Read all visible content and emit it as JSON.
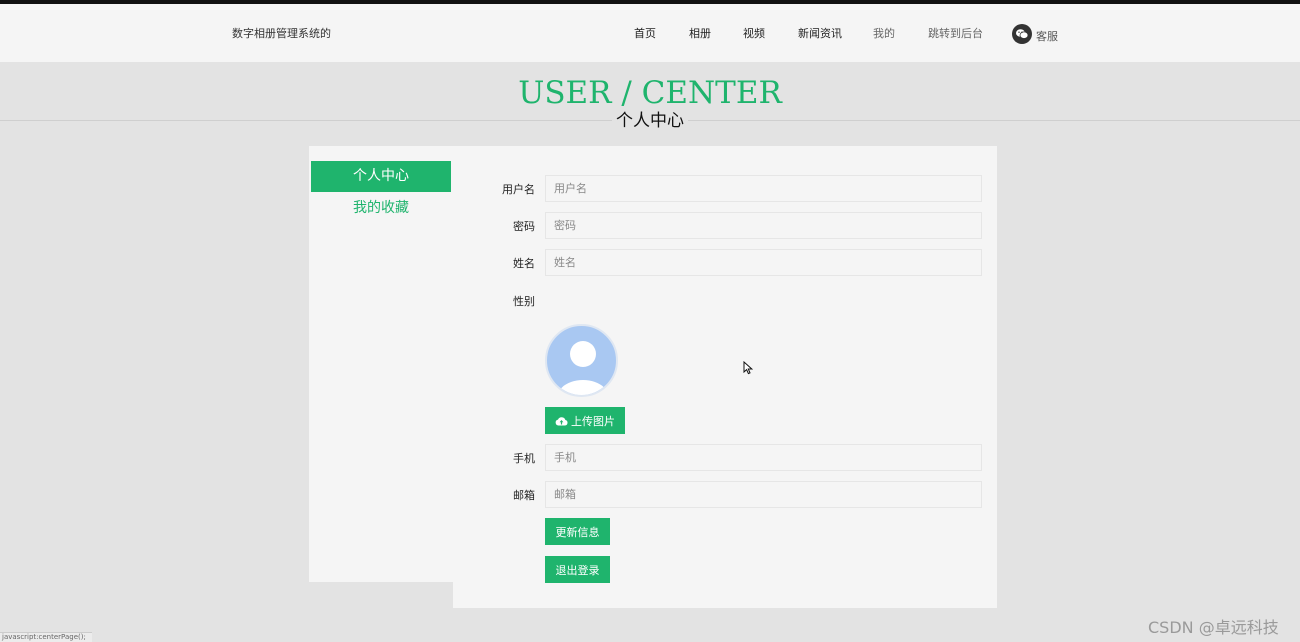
{
  "header": {
    "site_title": "数字相册管理系统的",
    "nav": {
      "home": "首页",
      "albums": "相册",
      "videos": "视频",
      "news": "新闻资讯",
      "mine": "我的",
      "backend": "跳转到后台",
      "service": "客服"
    }
  },
  "hero": {
    "title": "USER / CENTER",
    "subtitle": "个人中心"
  },
  "sidebar": {
    "items": [
      {
        "label": "个人中心",
        "active": true
      },
      {
        "label": "我的收藏",
        "active": false
      }
    ]
  },
  "form": {
    "username": {
      "label": "用户名",
      "placeholder": "用户名"
    },
    "password": {
      "label": "密码",
      "placeholder": "密码"
    },
    "name": {
      "label": "姓名",
      "placeholder": "姓名"
    },
    "gender": {
      "label": "性别"
    },
    "phone": {
      "label": "手机",
      "placeholder": "手机"
    },
    "email": {
      "label": "邮箱",
      "placeholder": "邮箱"
    },
    "upload_label": "上传图片",
    "update_label": "更新信息",
    "logout_label": "退出登录"
  },
  "statusbar": {
    "text": "javascript:centerPage();"
  },
  "watermark": "CSDN @卓远科技",
  "colors": {
    "accent": "#1fb46d",
    "avatar": "#a9c8f2",
    "page_bg": "#e3e3e3",
    "panel_bg": "#f5f5f5"
  }
}
